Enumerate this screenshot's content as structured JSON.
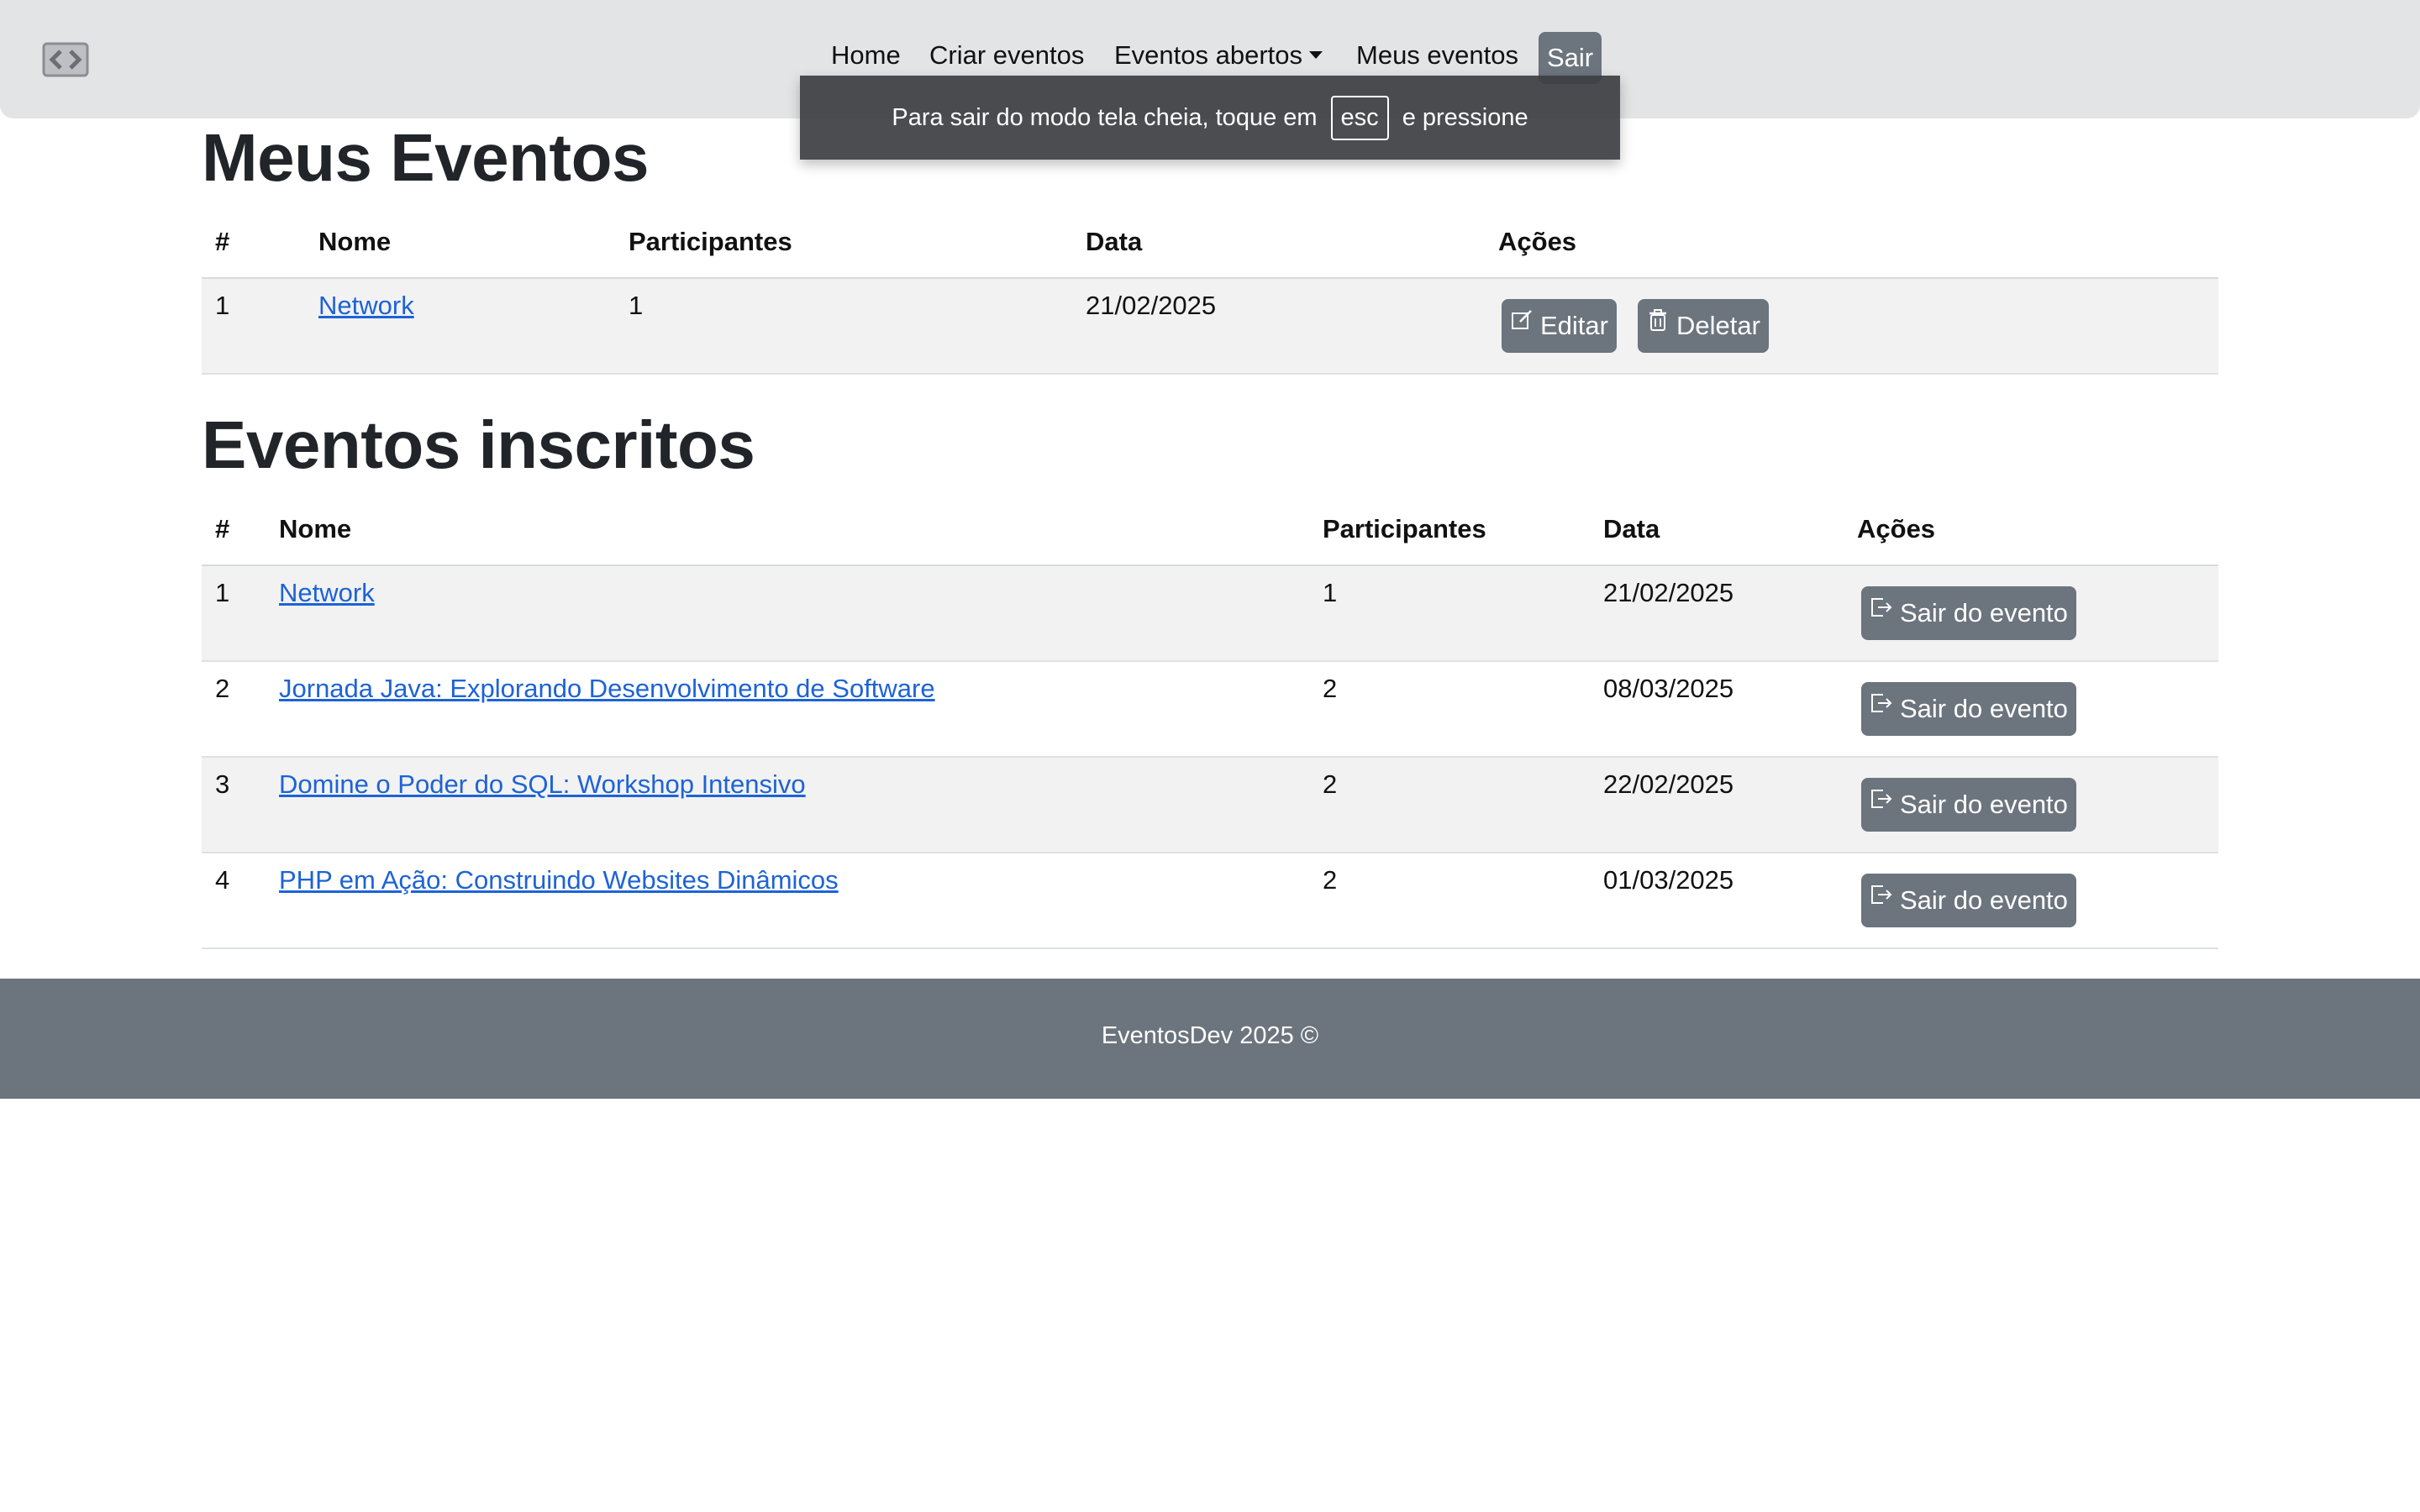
{
  "navbar": {
    "brand_icon": "code-brackets-icon",
    "items": [
      {
        "label": "Home"
      },
      {
        "label": "Criar eventos"
      },
      {
        "label": "Eventos abertos"
      },
      {
        "label": "Meus eventos"
      }
    ],
    "logout_label": "Sair"
  },
  "fullscreen_notice": {
    "before": "Para sair do modo tela cheia, toque em",
    "key": "esc",
    "after": "e pressione"
  },
  "my_events": {
    "title": "Meus Eventos",
    "headers": {
      "num": "#",
      "name": "Nome",
      "participants": "Participantes",
      "date": "Data",
      "actions": "Ações"
    },
    "rows": [
      {
        "num": "1",
        "name": "Network",
        "participants": "1",
        "date": "21/02/2025",
        "edit_label": "Editar",
        "delete_label": "Deletar"
      }
    ]
  },
  "subscribed_events": {
    "title": "Eventos inscritos",
    "headers": {
      "num": "#",
      "name": "Nome",
      "participants": "Participantes",
      "date": "Data",
      "actions": "Ações"
    },
    "leave_label": "Sair do evento",
    "rows": [
      {
        "num": "1",
        "name": "Network",
        "participants": "1",
        "date": "21/02/2025"
      },
      {
        "num": "2",
        "name": "Jornada Java: Explorando Desenvolvimento de Software",
        "participants": "2",
        "date": "08/03/2025"
      },
      {
        "num": "3",
        "name": "Domine o Poder do SQL: Workshop Intensivo",
        "participants": "2",
        "date": "22/02/2025"
      },
      {
        "num": "4",
        "name": "PHP em Ação: Construindo Websites Dinâmicos",
        "participants": "2",
        "date": "01/03/2025"
      }
    ]
  },
  "footer": {
    "text": "EventosDev 2025 ©"
  },
  "colors": {
    "button_bg": "#6c747e",
    "link": "#1d63d6",
    "navbar_bg": "#e3e4e6",
    "stripe": "#f2f2f2"
  }
}
